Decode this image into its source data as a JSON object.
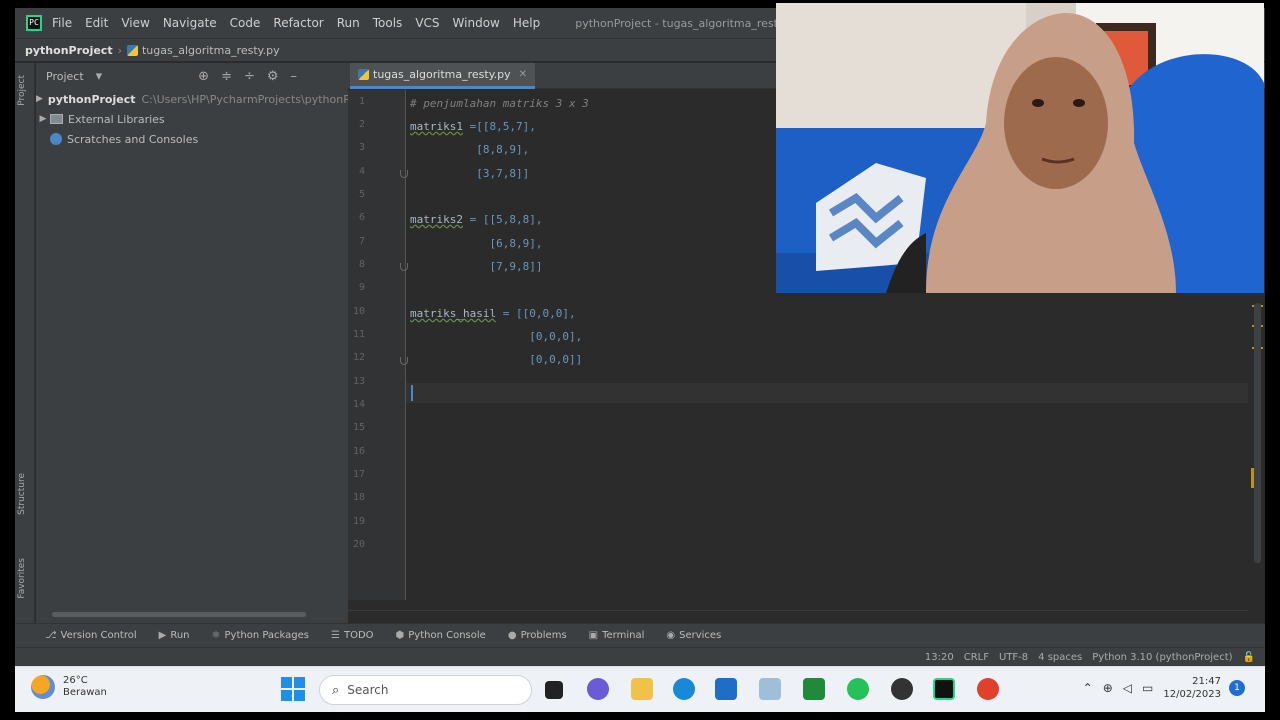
{
  "window_title": "pythonProject - tugas_algoritma_resty.py",
  "menu": [
    "File",
    "Edit",
    "View",
    "Navigate",
    "Code",
    "Refactor",
    "Run",
    "Tools",
    "VCS",
    "Window",
    "Help"
  ],
  "breadcrumb": {
    "project": "pythonProject",
    "file": "tugas_algoritma_resty.py"
  },
  "project_panel": {
    "title": "Project",
    "tree": [
      {
        "label": "pythonProject",
        "path": "C:\\Users\\HP\\PycharmProjects\\pythonProject"
      },
      {
        "label": "External Libraries"
      },
      {
        "label": "Scratches and Consoles"
      }
    ],
    "side_tabs": [
      "Project",
      "Structure",
      "Favorites"
    ]
  },
  "editor": {
    "tab": "tugas_algoritma_resty.py",
    "line_numbers": [
      "1",
      "2",
      "3",
      "4",
      "5",
      "6",
      "7",
      "8",
      "9",
      "10",
      "11",
      "12",
      "13",
      "14",
      "15",
      "16",
      "17",
      "18",
      "19",
      "20"
    ],
    "code": {
      "l1": "# penjumlahan matriks 3 x 3",
      "l2_name": "matriks1",
      "l2_rest": " =[[8,5,7],",
      "l3": "          [8,8,9],",
      "l4": "          [3,7,8]]",
      "l6_name": "matriks2",
      "l6_rest": " = [[5,8,8],",
      "l7": "            [6,8,9],",
      "l8": "            [7,9,8]]",
      "l10_name": "matriks_hasil",
      "l10_rest": " = [[0,0,0],",
      "l11": "                  [0,0,0],",
      "l12": "                  [0,0,0]]"
    }
  },
  "bottom_tools": [
    "Version Control",
    "Run",
    "Python Packages",
    "TODO",
    "Python Console",
    "Problems",
    "Terminal",
    "Services"
  ],
  "status_bar": [
    "13:20",
    "CRLF",
    "UTF-8",
    "4 spaces",
    "Python 3.10 (pythonProject)"
  ],
  "taskbar": {
    "weather_temp": "26°C",
    "weather_desc": "Berawan",
    "search_placeholder": "Search",
    "time": "21:47",
    "date": "12/02/2023",
    "notification_count": "1"
  },
  "colors": {
    "accent": "#4a88c7",
    "ide_bg": "#2b2b2b",
    "chrome_bg": "#3c3f41",
    "taskbar_bg": "#eef1f5"
  }
}
